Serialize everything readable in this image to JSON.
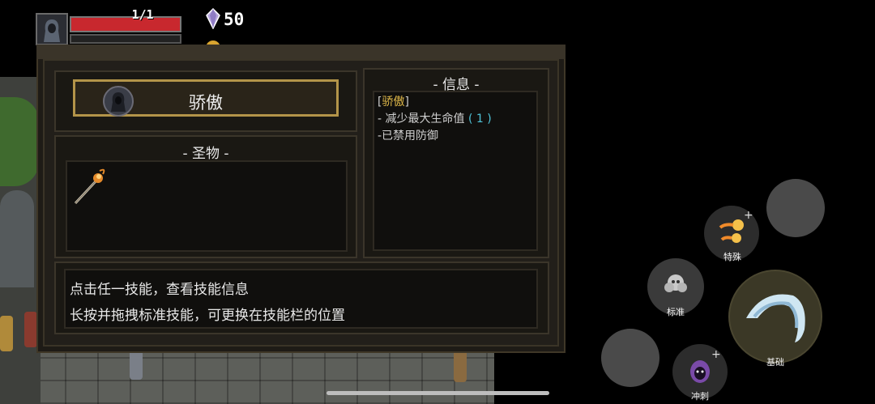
{
  "hud": {
    "hp_text": "1/1",
    "hp_fraction": 1.0,
    "gem_count": "50",
    "colors": {
      "hp": "#c8282e",
      "gem": "#b9a8e0",
      "coin": "#d9a530"
    }
  },
  "skill_panel": {
    "selected_skill": {
      "name": "骄傲",
      "icon": "hooded-figure-icon"
    },
    "relic_section_title": "- 圣物 -",
    "relics": [
      {
        "icon": "flaming-staff-icon"
      }
    ],
    "info_section_title": "- 信息 -",
    "info": {
      "name_open": "[",
      "name": "骄傲",
      "name_close": "]",
      "line1_text": "- 减少最大生命值 ",
      "line1_value_open": "( ",
      "line1_value": "1",
      "line1_value_close": " )",
      "line2_text": "-已禁用防御"
    },
    "help_lines": [
      "点击任一技能，查看技能信息",
      "长按并拖拽标准技能，可更换在技能栏的位置"
    ]
  },
  "controls": {
    "special_label": "特殊",
    "standard_label": "标准",
    "basic_label": "基础",
    "dash_label": "冲刺",
    "plus_symbol": "+",
    "accent_color": "#e0d89a"
  }
}
